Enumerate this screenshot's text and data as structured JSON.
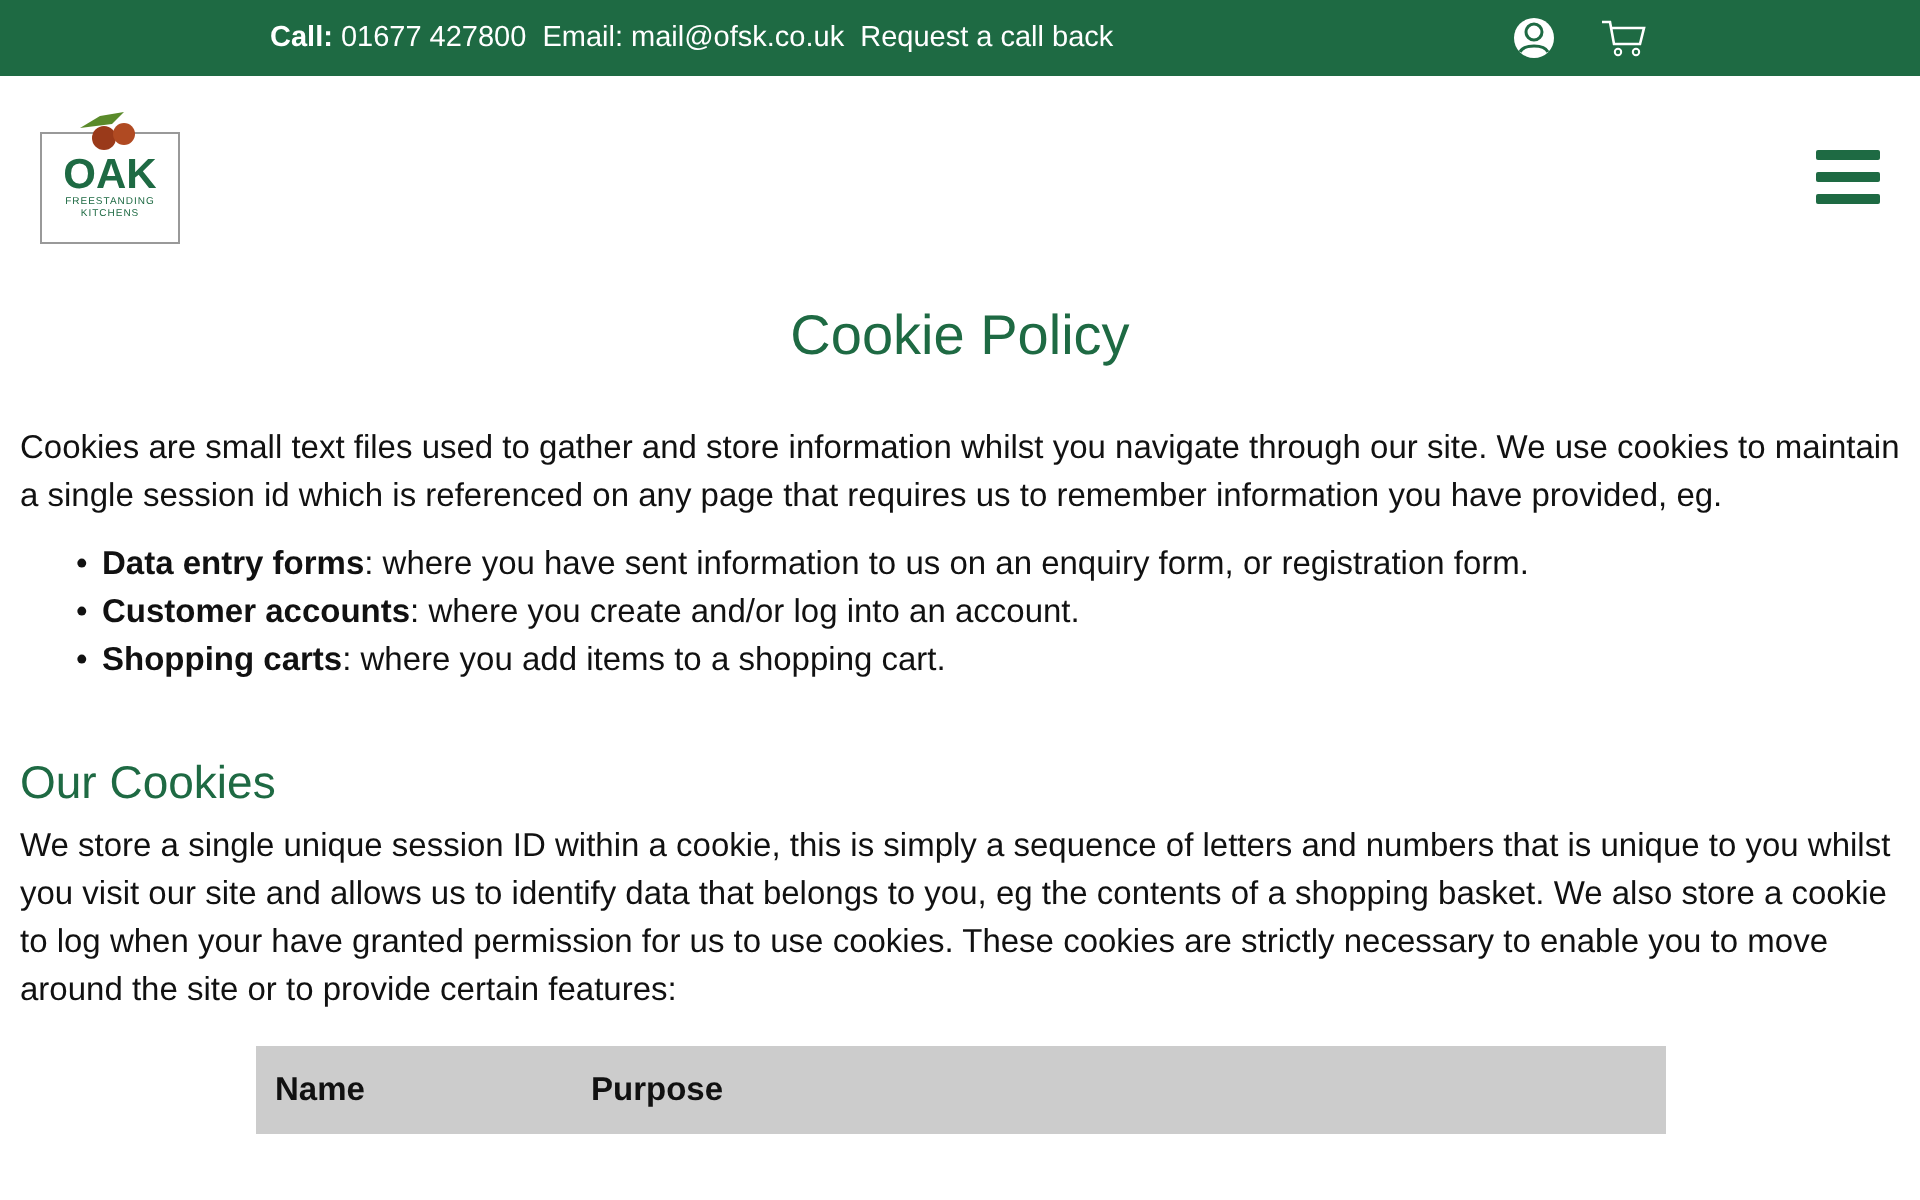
{
  "top_bar": {
    "call": "**Call:** 01677 427800",
    "email": "Email: mail@ofsk.co.uk",
    "callback_link": "Request a call back"
  },
  "logo": {
    "name": "OAK",
    "line_1": "FREESTANDING",
    "line_2": "KITCHENS"
  },
  "title": "Cookie Policy",
  "intro": "Cookies are small text files used to gather and store information whilst you navigate through our site.  We use cookies to maintain a single session id which is referenced on any page that requires us to remember information you have provided, eg.",
  "uses": [
    {
      "marker": "•",
      "text": "**Data entry forms**: where you have sent information to us on an enquiry form, or registration form."
    },
    {
      "marker": "•",
      "text": "**Customer accounts**: where you create and/or log into an account."
    },
    {
      "marker": "•",
      "text": "**Shopping carts**: where you add items to a shopping cart."
    }
  ],
  "section": {
    "heading": "Our Cookies",
    "text": "We store a single unique session ID within a cookie, this is simply a sequence of letters and numbers that is unique to you whilst you visit our site and allows us to identify data that belongs to you, eg the contents of a shopping basket. We also store a cookie to log when your have granted permission for us to use cookies.  These cookies are strictly necessary to enable you to move around the site or to provide certain features:"
  },
  "table": {
    "columns": [
      "Name",
      "Purpose"
    ]
  }
}
